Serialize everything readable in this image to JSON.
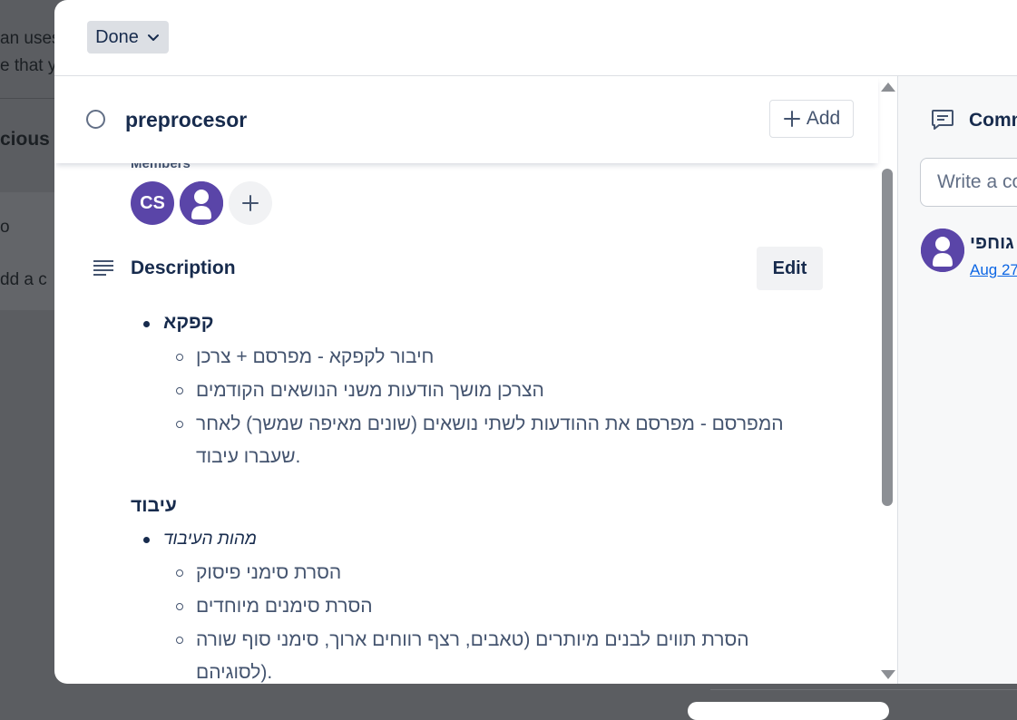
{
  "background": {
    "snippets": [
      "an uses",
      "e that y",
      "cious",
      "o",
      "dd a c"
    ]
  },
  "modal": {
    "status_label": "Done",
    "card_title": "preprocesor",
    "add_label": "Add",
    "members_label": "Members",
    "members": [
      {
        "initials": "CS"
      },
      {
        "initials": ""
      }
    ],
    "description_label": "Description",
    "edit_label": "Edit",
    "description": {
      "kafka_heading": "קפקא",
      "kafka_items": [
        "חיבור לקפקא - מפרסם + צרכן",
        "הצרכן מושך הודעות משני הנושאים הקודמים",
        "המפרסם - מפרסם את ההודעות לשתי נושאים (שונים מאיפה שמשך) לאחר",
        "שעברו עיבוד."
      ],
      "processing_heading": "עיבוד",
      "processing_sub": "מהות העיבוד",
      "processing_items": [
        "הסרת סימני פיסוק",
        "הסרת סימנים מיוחדים",
        "הסרת תווים לבנים מיותרים (טאבים, רצף רווחים ארוך, סימני סוף שורה",
        "לסוגיהם)."
      ]
    }
  },
  "comments": {
    "title": "Comments",
    "input_placeholder": "Write a comment…",
    "author": "גוחפי",
    "date": "Aug 27"
  }
}
